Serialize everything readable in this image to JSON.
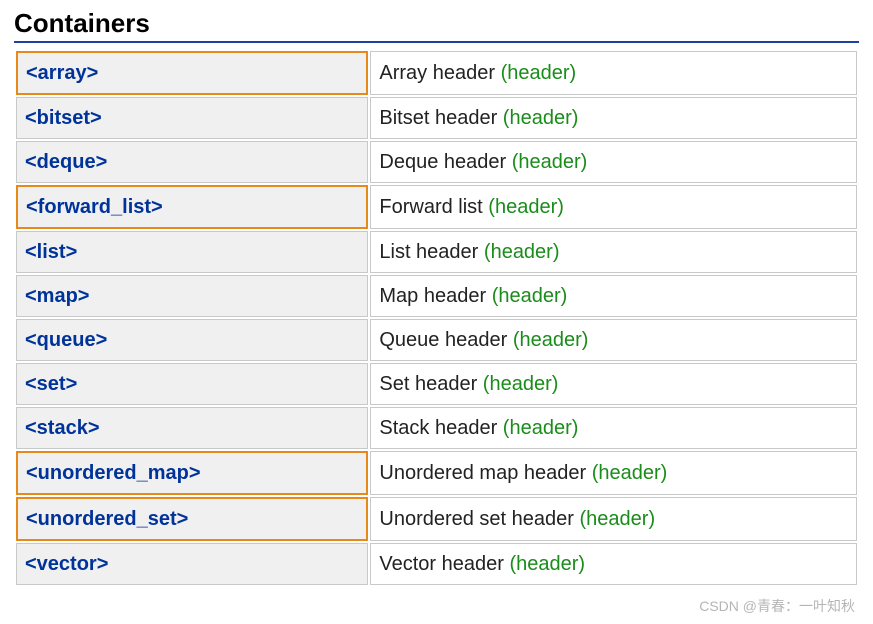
{
  "title": "Containers",
  "type_tag": "(header)",
  "rows": [
    {
      "name": "<array>",
      "desc": "Array header",
      "highlight": true
    },
    {
      "name": "<bitset>",
      "desc": "Bitset header",
      "highlight": false
    },
    {
      "name": "<deque>",
      "desc": "Deque header",
      "highlight": false
    },
    {
      "name": "<forward_list>",
      "desc": "Forward list",
      "highlight": true
    },
    {
      "name": "<list>",
      "desc": "List header",
      "highlight": false
    },
    {
      "name": "<map>",
      "desc": "Map header",
      "highlight": false
    },
    {
      "name": "<queue>",
      "desc": "Queue header",
      "highlight": false
    },
    {
      "name": "<set>",
      "desc": "Set header",
      "highlight": false
    },
    {
      "name": "<stack>",
      "desc": "Stack header",
      "highlight": false
    },
    {
      "name": "<unordered_map>",
      "desc": "Unordered map header",
      "highlight": true
    },
    {
      "name": "<unordered_set>",
      "desc": "Unordered set header",
      "highlight": true
    },
    {
      "name": "<vector>",
      "desc": "Vector header",
      "highlight": false
    }
  ],
  "watermark": "CSDN @青春：一叶知秋"
}
